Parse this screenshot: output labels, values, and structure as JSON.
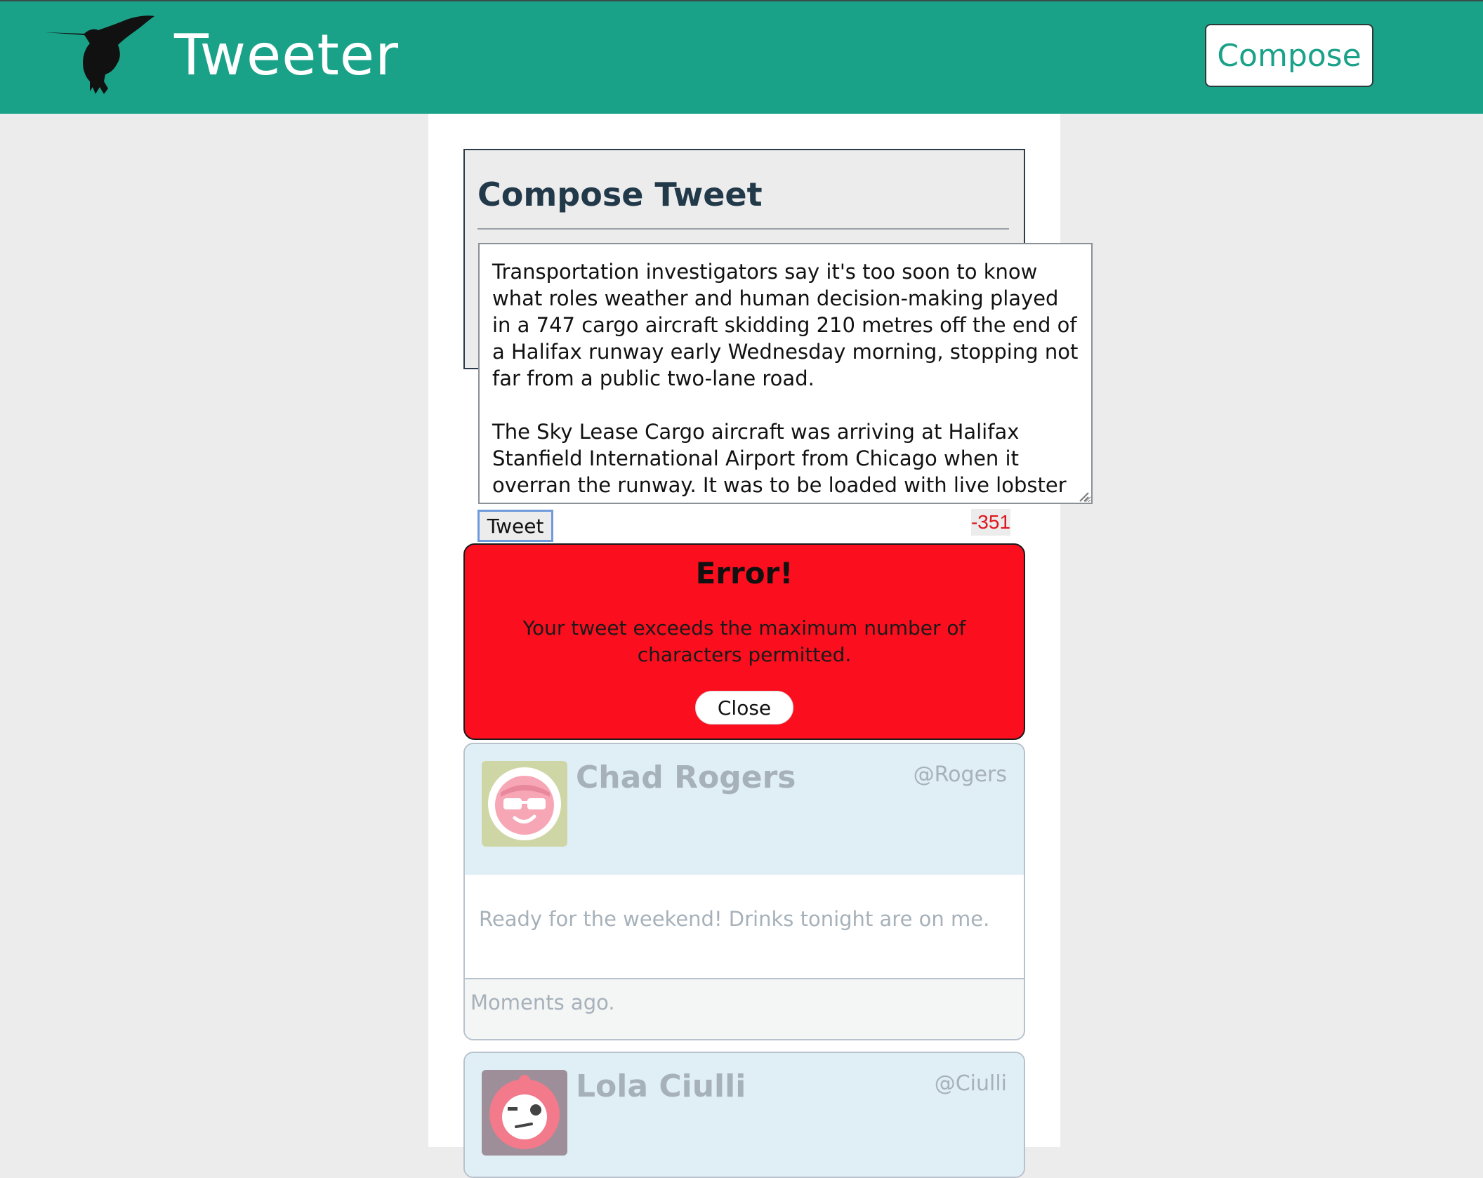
{
  "header": {
    "app_title": "Tweeter",
    "compose_label": "Compose",
    "logo_icon": "hummingbird-icon",
    "bar_color": "#1aa289"
  },
  "compose": {
    "title": "Compose Tweet",
    "text": "Transportation investigators say it's too soon to know what roles weather and human decision-making played in a 747 cargo aircraft skidding 210 metres off the end of a Halifax runway early Wednesday morning, stopping not far from a public two-lane road.\n\nThe Sky Lease Cargo aircraft was arriving at Halifax Stanfield International Airport from Chicago when it overran the runway. It was to be loaded with live lobster in Halifax before heading to China, with a stop along the way in Alaska.",
    "tweet_label": "Tweet",
    "char_counter": "-351"
  },
  "error": {
    "title": "Error!",
    "message": "Your tweet exceeds the maximum number of characters permitted.",
    "close_label": "Close",
    "color": "#fb0e1e"
  },
  "tweets": [
    {
      "name": "Chad Rogers",
      "handle": "@Rogers",
      "text": "Ready for the weekend! Drinks tonight are on me.",
      "time": "Moments ago.",
      "avatar_icon": "sunglasses-face-icon"
    },
    {
      "name": "Lola Ciulli",
      "handle": "@Ciulli",
      "avatar_icon": "winking-face-icon"
    }
  ]
}
